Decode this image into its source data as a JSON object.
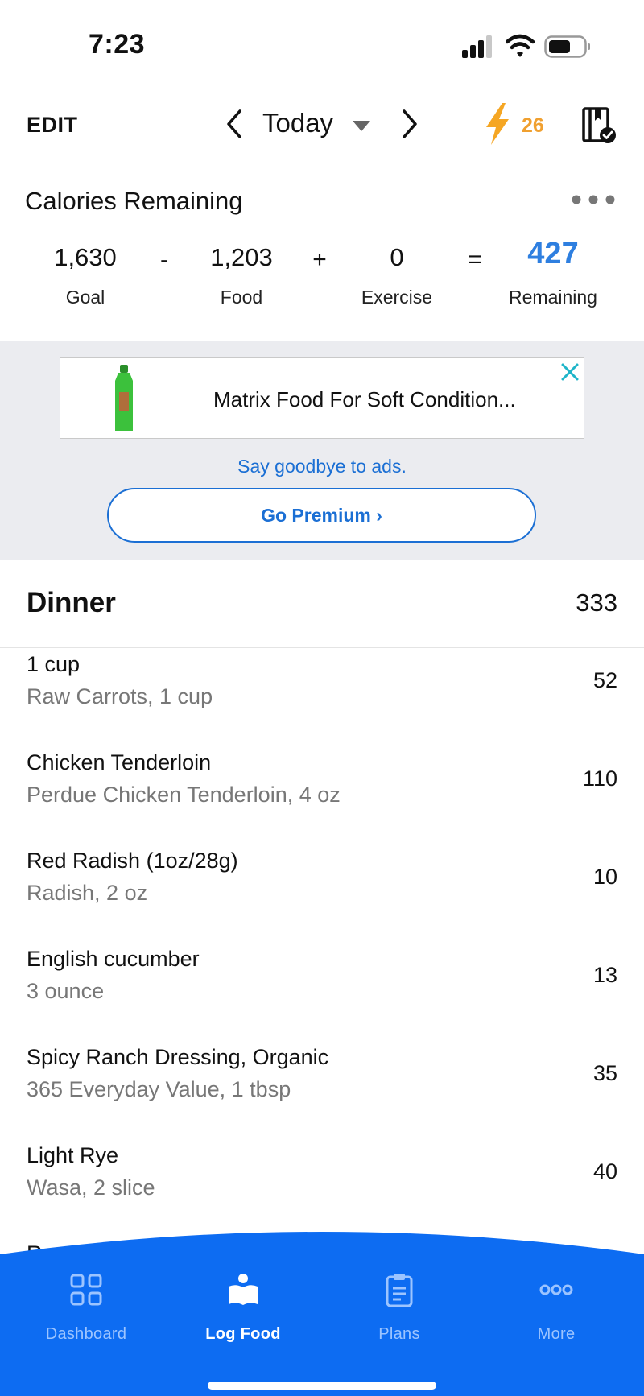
{
  "status_bar": {
    "time": "7:23"
  },
  "top_nav": {
    "edit_label": "EDIT",
    "date_label": "Today",
    "streak_count": "26",
    "icons": [
      "chevron-left-icon",
      "caret-down-icon",
      "chevron-right-icon",
      "bolt-icon",
      "diary-check-icon"
    ]
  },
  "calories": {
    "title": "Calories Remaining",
    "goal": {
      "value": "1,630",
      "label": "Goal"
    },
    "food": {
      "value": "1,203",
      "label": "Food"
    },
    "exercise": {
      "value": "0",
      "label": "Exercise"
    },
    "remaining": {
      "value": "427",
      "label": "Remaining"
    },
    "operators": [
      "-",
      "+",
      "="
    ]
  },
  "ad": {
    "text": "Matrix Food For Soft Condition...",
    "goodbye_text": "Say goodbye to ads.",
    "premium_label": "Go Premium ›"
  },
  "meal": {
    "title": "Dinner",
    "total": "333",
    "items": [
      {
        "name": "1 cup",
        "desc": "Raw Carrots, 1 cup",
        "calories": "52"
      },
      {
        "name": "Chicken Tenderloin",
        "desc": "Perdue Chicken Tenderloin, 4 oz",
        "calories": "110"
      },
      {
        "name": "Red Radish (1oz/28g)",
        "desc": "Radish, 2 oz",
        "calories": "10"
      },
      {
        "name": "English cucumber",
        "desc": "3 ounce",
        "calories": "13"
      },
      {
        "name": "Spicy Ranch Dressing, Organic",
        "desc": "365 Everyday Value, 1 tbsp",
        "calories": "35"
      },
      {
        "name": "Light Rye",
        "desc": "Wasa, 2 slice",
        "calories": "40"
      },
      {
        "name": "Romaine",
        "desc": "",
        "calories": ""
      }
    ]
  },
  "bottom_nav": {
    "items": [
      {
        "label": "Dashboard",
        "icon": "grid-icon"
      },
      {
        "label": "Log Food",
        "icon": "book-icon",
        "active": true
      },
      {
        "label": "Plans",
        "icon": "clipboard-icon"
      },
      {
        "label": "More",
        "icon": "more-dots-icon"
      }
    ]
  },
  "colors": {
    "accent_blue": "#2e7fe0",
    "nav_blue": "#0d6cf2",
    "streak_orange": "#f0a030",
    "ad_close_teal": "#1fb5c9"
  }
}
